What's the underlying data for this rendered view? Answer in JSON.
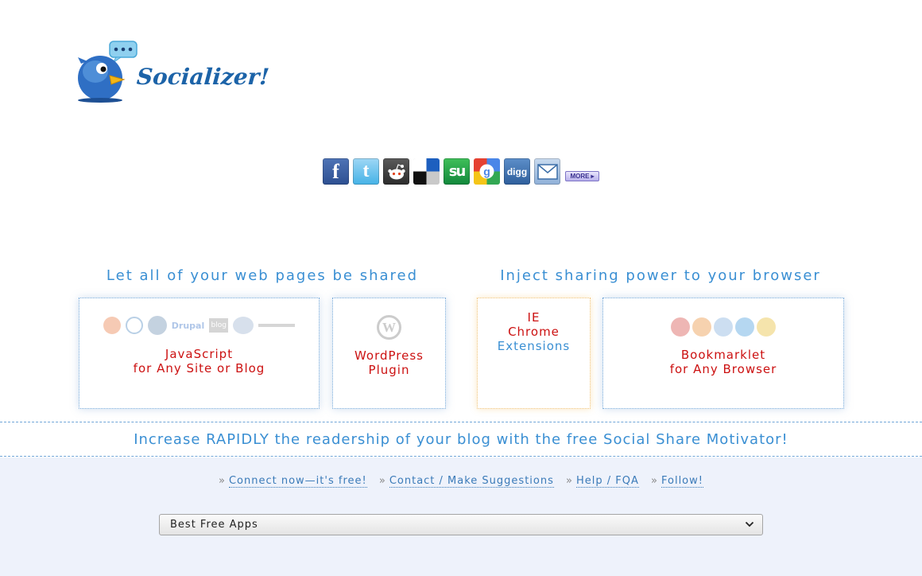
{
  "logo": {
    "wordmark": "Socializer!",
    "alt": "Socializer bird logo"
  },
  "share_icons": [
    {
      "name": "facebook",
      "glyph": "f"
    },
    {
      "name": "twitter",
      "glyph": "t"
    },
    {
      "name": "reddit",
      "glyph": ""
    },
    {
      "name": "delicious",
      "glyph": ""
    },
    {
      "name": "stumbleupon",
      "glyph": "su"
    },
    {
      "name": "google",
      "glyph": ""
    },
    {
      "name": "digg",
      "glyph": "digg"
    },
    {
      "name": "email",
      "glyph": ""
    }
  ],
  "more_label": "MORE",
  "sections": {
    "left_heading": "Let all of your web pages be shared",
    "right_heading": "Inject sharing power to your browser"
  },
  "cards": {
    "javascript": {
      "line1": "JavaScript",
      "line2": "for Any Site or Blog",
      "platforms": [
        "Drupal",
        "blog"
      ]
    },
    "wordpress": {
      "line1": "WordPress",
      "line2": "Plugin"
    },
    "extensions": {
      "line1": "IE",
      "line2": "Chrome",
      "line3": "Extensions"
    },
    "bookmarklet": {
      "line1": "Bookmarklet",
      "line2": "for Any Browser"
    }
  },
  "banner": "Increase RAPIDLY the readership of your blog with the free Social Share Motivator!",
  "links": {
    "sep": "»",
    "connect": "Connect now—it's free!",
    "contact": "Contact / Make Suggestions",
    "help": "Help / FQA",
    "follow": "Follow!"
  },
  "select": {
    "value": "Best Free Apps"
  },
  "colors": {
    "accent": "#3a8fd3",
    "cta": "#cc1111",
    "footer_bg": "#eef2fb"
  }
}
